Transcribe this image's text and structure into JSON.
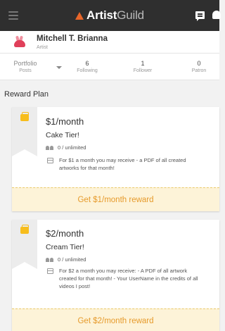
{
  "app": {
    "logo_main": "Artist",
    "logo_accent": "Guild"
  },
  "icons": {
    "menu": "hamburger-menu-icon",
    "chat": "chat-icon",
    "bell": "bell-icon",
    "brand": "artistguild-logo-icon"
  },
  "colors": {
    "topbar": "#2f2f2f",
    "brand_orange": "#e8662a",
    "reward_accent": "#e69a2b",
    "reward_bg": "#fdf3d8",
    "ribbon_icon": "#f7bd1c"
  },
  "profile": {
    "name": "Mitchell T. Brianna",
    "role": "Artist"
  },
  "stats": {
    "portfolio": {
      "value": "Portfolio",
      "label": "Posts"
    },
    "following": {
      "value": "6",
      "label": "Following"
    },
    "follower": {
      "value": "1",
      "label": "Follower"
    },
    "patron": {
      "value": "0",
      "label": "Patron"
    }
  },
  "section_title": "Reward Plan",
  "rewards": [
    {
      "price": "$1/month",
      "tier": "Cake Tier!",
      "limit": "0 / unlimited",
      "description": "For $1 a month you may receive - a PDF of all created artworks for that month!",
      "button": "Get $1/month reward"
    },
    {
      "price": "$2/month",
      "tier": "Cream Tier!",
      "limit": "0 / unlimited",
      "description": "For $2 a month you may receive: - A PDF of all artwork created for that month! - Your UserName in the credits of all videos I post!",
      "button": "Get $2/month reward"
    }
  ]
}
